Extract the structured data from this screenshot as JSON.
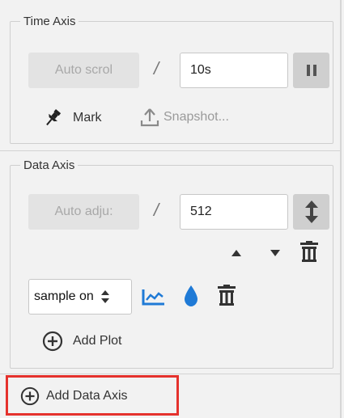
{
  "time_axis": {
    "legend": "Time Axis",
    "auto_scroll_label": "Auto scrol",
    "separator": "/",
    "range_value": "10s",
    "pause_icon": "pause-icon",
    "mark_label": "Mark",
    "snapshot_label": "Snapshot..."
  },
  "data_axis": {
    "legend": "Data Axis",
    "auto_adjust_label": "Auto adju:",
    "separator": "/",
    "range_value": "512",
    "expand_icon": "vertical-resize-icon",
    "plot_select_value": "sample on",
    "add_plot_label": "Add Plot"
  },
  "footer": {
    "add_data_axis_label": "Add Data Axis"
  },
  "colors": {
    "accent_blue": "#1f7ad6",
    "highlight_red": "#e5322d"
  }
}
